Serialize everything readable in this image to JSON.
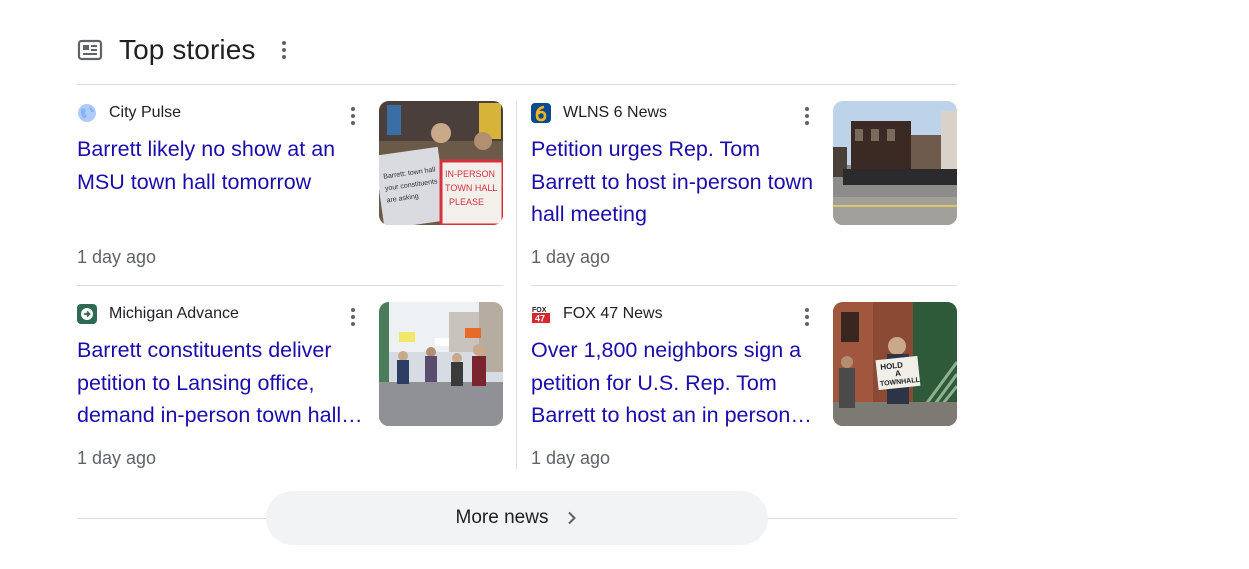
{
  "section": {
    "title": "Top stories",
    "header_icon": "newspaper-icon",
    "menu_icon": "more-vert-icon"
  },
  "stories": [
    {
      "source": "City Pulse",
      "source_icon": "globe-icon",
      "headline": "Barrett likely no show at an MSU town hall tomorrow",
      "age": "1 day ago",
      "thumb_sign_1": "IN-PERSON",
      "thumb_sign_2": "TOWN HALL",
      "thumb_sign_3": "PLEASE"
    },
    {
      "source": "WLNS 6 News",
      "source_icon": "wlns-6-logo-icon",
      "headline": "Petition urges Rep. Tom Barrett to host in-person town hall meeting",
      "age": "1 day ago"
    },
    {
      "source": "Michigan Advance",
      "source_icon": "michigan-advance-logo-icon",
      "headline": "Barrett constituents deliver petition to Lansing office, demand in-person town hall…",
      "age": "1 day ago"
    },
    {
      "source": "FOX 47 News",
      "source_icon": "fox-47-logo-icon",
      "headline": "Over 1,800 neighbors sign a petition for U.S. Rep. Tom Barrett to host an in person…",
      "age": "1 day ago",
      "thumb_sign_1": "HOLD",
      "thumb_sign_2": "A",
      "thumb_sign_3": "TOWNHALL"
    }
  ],
  "more_news": {
    "label": "More news",
    "icon": "chevron-right-icon"
  },
  "colors": {
    "headline": "#1a0dab",
    "meta": "#5f6368",
    "divider": "#dadce0",
    "button_bg": "#f1f3f4"
  }
}
